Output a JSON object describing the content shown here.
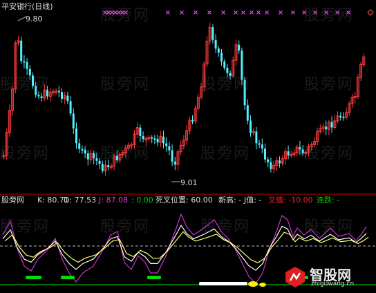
{
  "header": {
    "title": "平安银行(日线)"
  },
  "price_labels": {
    "high": "9.80",
    "low": "9.01"
  },
  "indicator_bar": [
    {
      "text": "股旁网",
      "color": "#dddddd"
    },
    {
      "text": "K: 80.71",
      "color": "#dddddd"
    },
    {
      "text": "D: 77.53",
      "color": "#dddddd"
    },
    {
      "text": "J: 87.08",
      "color": "#cc44cc"
    },
    {
      "text": ": 0.00",
      "color": "#00cc00"
    },
    {
      "text": "死叉位置: 60.00",
      "color": "#dddddd"
    },
    {
      "text": "新高: -",
      "color": "#dddddd"
    },
    {
      "text": "J值: -",
      "color": "#dddddd"
    },
    {
      "text": "叉值: -10.00",
      "color": "#ee2222"
    },
    {
      "text": "连跌: -",
      "color": "#00cc00"
    }
  ],
  "watermark": "股旁网",
  "logo": {
    "name": "智股网",
    "url": "zhiguwang.cn"
  },
  "colors": {
    "up": "#ff3b3b",
    "down": "#54f0ff",
    "cross": "#ff44ff",
    "diamond": "#ff3b3b",
    "k_line": "#ffffff",
    "d_line": "#ffff66",
    "j_line": "#cc33cc",
    "signal": "#00dd00"
  }
}
